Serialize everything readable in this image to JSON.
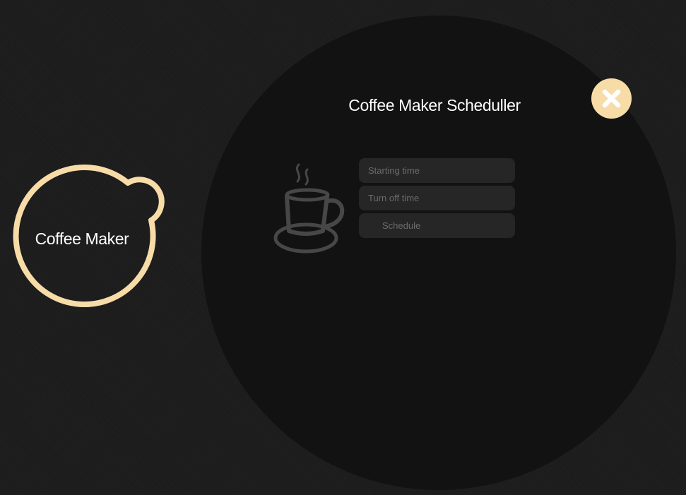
{
  "launcher": {
    "label": "Coffee Maker",
    "ring_color": "#f7dca8"
  },
  "panel": {
    "title": "Coffee Maker Scheduller",
    "close_icon": "close-icon",
    "cup_icon": "coffee-cup-icon",
    "starting_time": {
      "value": "",
      "placeholder": "Starting time"
    },
    "turn_off_time": {
      "value": "",
      "placeholder": "Turn off time"
    },
    "schedule_label": "Schedule"
  },
  "colors": {
    "background": "#1c1c1c",
    "panel": "#121212",
    "accent": "#f7dca8",
    "field": "#262626",
    "placeholder": "#6b6b6b",
    "text": "#ffffff"
  }
}
